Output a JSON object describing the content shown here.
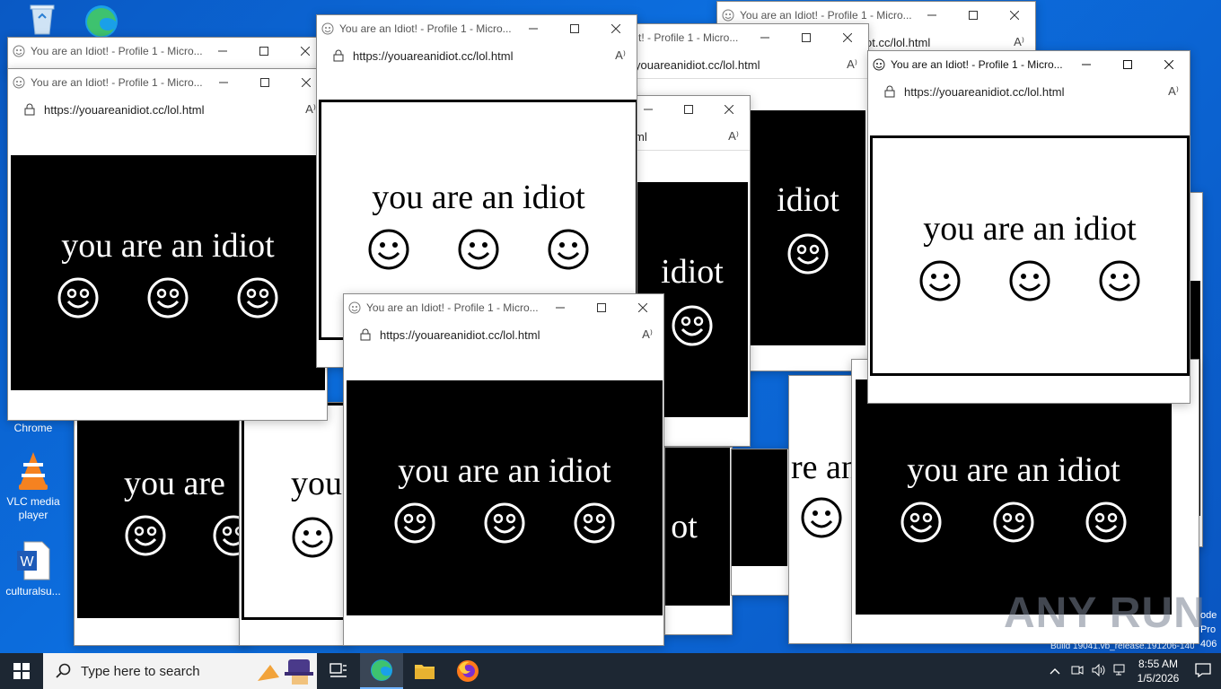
{
  "desktop": {
    "icons": [
      {
        "label": "Chrome"
      },
      {
        "label": "VLC media player"
      },
      {
        "label": "culturalsu..."
      }
    ],
    "watermark": "ANY RUN",
    "corner_texts": [
      "ode",
      "Pro",
      "406",
      "Build 19041.vb_release.191206-1406"
    ]
  },
  "window": {
    "title": "You are an Idiot! - Profile 1 - Micro...",
    "url": "https://youareanidiot.cc/lol.html",
    "url_fragment_a": "ot.cc/lol.html",
    "url_fragment_b": "youareanidiot.cc/lol.html",
    "url_fragment_c": "ml",
    "title_fragment": "t! - Profile 1 - Micro...",
    "read_aloud_glyph": "A⁾"
  },
  "page": {
    "phrase": "you are an idiot",
    "fragments": [
      "you are",
      "you",
      "idiot",
      "ot",
      "re an"
    ]
  },
  "taskbar": {
    "search_placeholder": "Type here to search",
    "time": "8:55 AM",
    "date": "1/5/2026"
  }
}
